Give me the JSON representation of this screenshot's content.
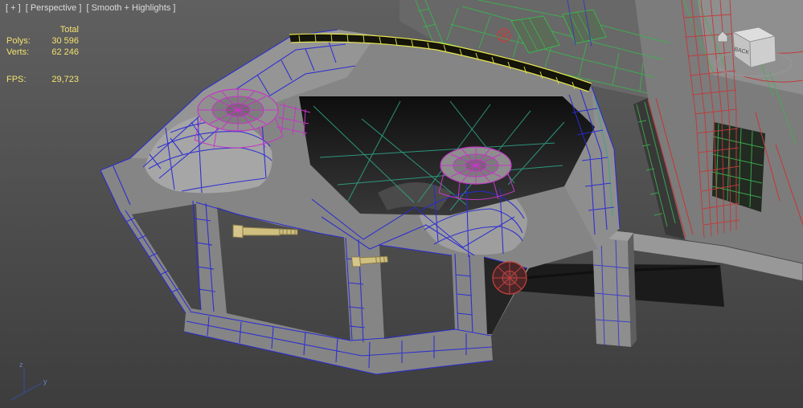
{
  "viewport": {
    "general_menu": "[ + ]",
    "pov_menu": "[ Perspective ]",
    "shading_menu": "[ Smooth + Highlights ]"
  },
  "stats": {
    "total_header": "Total",
    "polys": {
      "label": "Polys:",
      "value": "30 596"
    },
    "verts": {
      "label": "Verts:",
      "value": "62 246"
    },
    "fps": {
      "label": "FPS:",
      "value": "29,723"
    }
  },
  "viewcube": {
    "face_label": "BACK"
  },
  "axis_gizmo": {
    "z": "z",
    "y": "y"
  },
  "colors": {
    "stats_text": "#f2e270",
    "label_text": "#dcdcdc",
    "wire_blue": "#2a2ad4",
    "wire_purple": "#c438c4",
    "wire_green": "#3cb34f",
    "wire_teal": "#2fa98c",
    "wire_red": "#c23a3a",
    "wire_yellow": "#e8e850",
    "background_top": "#606060",
    "background_bottom": "#3d3d3d"
  }
}
